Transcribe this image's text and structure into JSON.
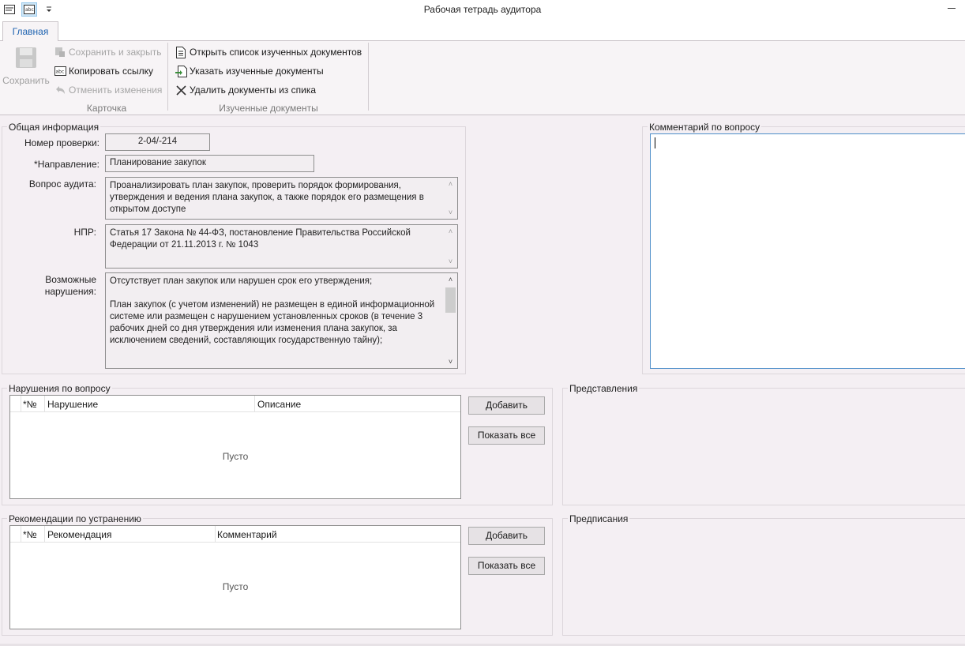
{
  "window": {
    "title": "Рабочая тетрадь аудитора"
  },
  "ribbon": {
    "tab": "Главная",
    "save_label": "Сохранить",
    "save_close_label": "Сохранить и закрыть",
    "copy_link_label": "Копировать ссылку",
    "undo_label": "Отменить изменения",
    "group_card": "Карточка",
    "open_docs_label": "Открыть список изученных документов",
    "mark_docs_label": "Указать изученные документы",
    "delete_docs_label": "Удалить документы из спика",
    "group_docs": "Изученные документы"
  },
  "general": {
    "title": "Общая информация",
    "check_number_label": "Номер проверки:",
    "check_number": "2-04/-214",
    "direction_label": "*Направление:",
    "direction": "Планирование закупок",
    "question_label": "Вопрос аудита:",
    "question": "Проанализировать план закупок, проверить порядок формирования, утверждения и ведения плана закупок, а также порядок его размещения в открытом доступе",
    "npr_label": "НПР:",
    "npr": "Статья 17 Закона № 44-ФЗ, постановление Правительства Российской Федерации от 21.11.2013 г. № 1043",
    "violations_label_1": "Возможные",
    "violations_label_2": "нарушения:",
    "violations_text": "Отсутствует план закупок или нарушен срок его утверждения;\n\nПлан закупок (с учетом изменений) не размещен в единой информационной системе или размещен с нарушением установленных сроков (в течение 3 рабочих дней со дня утверждения или изменения плана закупок, за исключением сведений, составляющих государственную тайну);"
  },
  "comment": {
    "title": "Комментарий по вопросу",
    "value": ""
  },
  "violations": {
    "title": "Нарушения по вопросу",
    "columns": [
      "*№",
      "Нарушение",
      "Описание"
    ],
    "empty_text": "Пусто",
    "add_label": "Добавить",
    "show_all_label": "Показать все"
  },
  "representations": {
    "title": "Представления"
  },
  "recommendations": {
    "title": "Рекомендации по устранению",
    "columns": [
      "*№",
      "Рекомендация",
      "Комментарий"
    ],
    "empty_text": "Пусто",
    "add_label": "Добавить",
    "show_all_label": "Показать все"
  },
  "prescriptions": {
    "title": "Предписания"
  }
}
